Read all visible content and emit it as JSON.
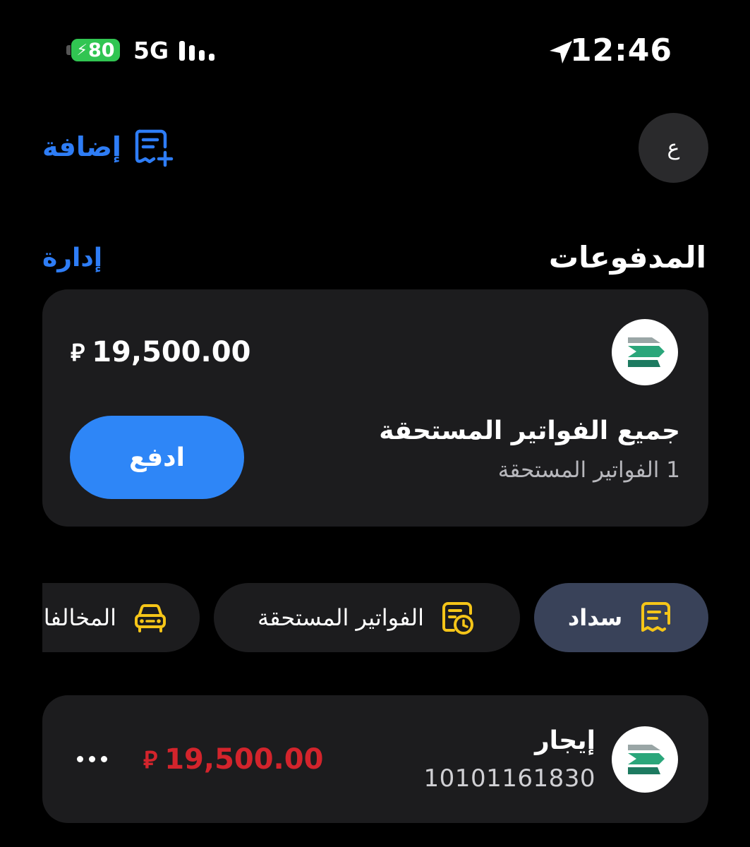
{
  "status_bar": {
    "battery": "80",
    "network": "5G",
    "time": "12:46",
    "icons": [
      "battery-charging-icon",
      "signal-bars-icon",
      "location-arrow-icon"
    ]
  },
  "header": {
    "add_label": "إضافة",
    "add_icon": "add-bill-icon",
    "avatar_initial": "ع"
  },
  "payments": {
    "title": "المدفوعات",
    "manage_label": "إدارة"
  },
  "summary": {
    "amount": "19,500.00",
    "currency_symbol": "⃁",
    "title": "جميع الفواتير المستحقة",
    "count_text": "1 الفواتير المستحقة",
    "pay_label": "ادفع",
    "biller_icon": "biller-logo-icon"
  },
  "chips": [
    {
      "label": "سداد",
      "icon": "sadad-receipt-icon",
      "selected": true
    },
    {
      "label": "الفواتير المستحقة",
      "icon": "due-bills-clock-icon",
      "selected": false
    },
    {
      "label": "المخالفات",
      "icon": "car-icon",
      "selected": false
    }
  ],
  "bill": {
    "name": "إيجار",
    "account": "10101161830",
    "amount": "19,500.00",
    "currency_symbol": "⃁",
    "more_icon": "more-dots-icon"
  },
  "colors": {
    "background": "#000000",
    "card": "#1c1c1e",
    "accent_blue": "#2e7df6",
    "pay_button": "#2e86f7",
    "chip_selected": "#394259",
    "icon_yellow": "#f5c518",
    "amount_red": "#d3242c",
    "battery_green": "#31c552"
  }
}
